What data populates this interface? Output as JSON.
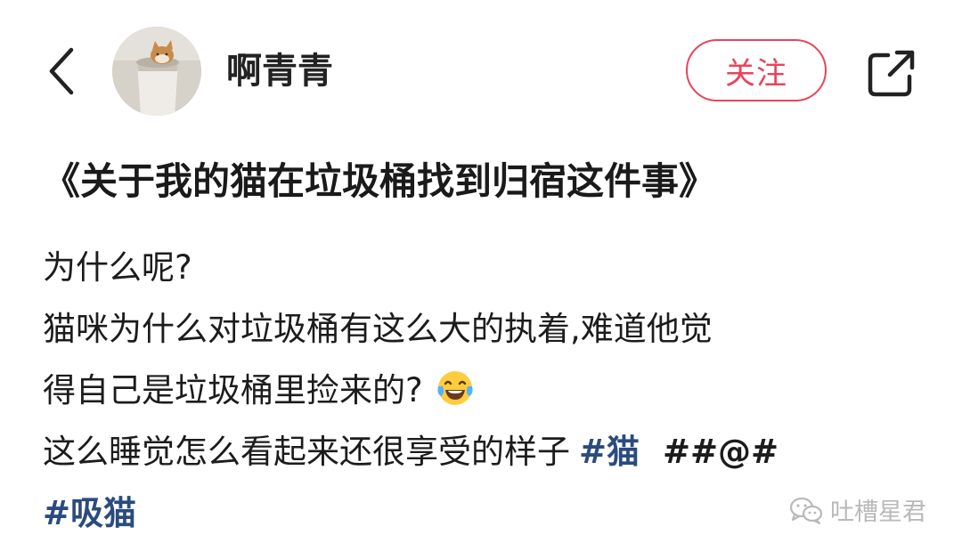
{
  "header": {
    "username": "啊青青",
    "follow_label": "关注"
  },
  "post": {
    "title": "《关于我的猫在垃圾桶找到归宿这件事》",
    "lines": {
      "l1": "为什么呢?",
      "l2": "猫咪为什么对垃圾桶有这么大的执着,难道他觉",
      "l3": "得自己是垃圾桶里捡来的?",
      "l4": "这么睡觉怎么看起来还很享受的样子"
    },
    "hashtags": {
      "cat": "#猫",
      "symbols": "##@#",
      "cat_lover": "#吸猫"
    },
    "emoji": "tears-of-joy-emoji"
  },
  "watermark": {
    "text": "吐槽星君",
    "icon": "wechat-icon"
  },
  "colors": {
    "accent": "#e8445a",
    "hashtag": "#2b4b7e",
    "text": "#1c1c1c",
    "watermark": "#b9b9b9"
  }
}
